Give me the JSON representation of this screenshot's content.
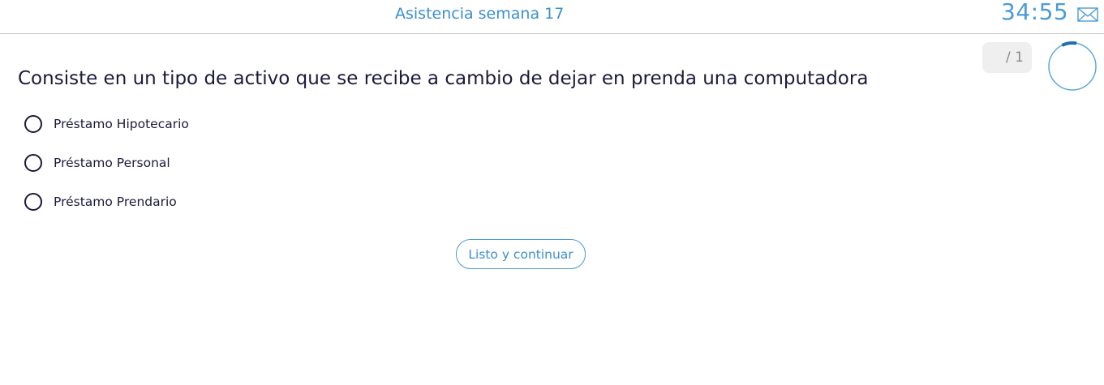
{
  "header": {
    "title": "Asistencia semana 17",
    "timer": "34:55",
    "mail_icon": "envelope-icon"
  },
  "progress": {
    "counter_text": "/ 1",
    "ring_fraction": 0.1,
    "ring_color": "#1f6fa8",
    "ring_track_color": "#5aa9dc"
  },
  "question": {
    "text": "Consiste en un tipo de activo que se recibe a cambio de dejar en prenda una computadora",
    "options": [
      {
        "label": "Préstamo Hipotecario",
        "selected": false
      },
      {
        "label": "Préstamo Personal",
        "selected": false
      },
      {
        "label": "Préstamo Prendario",
        "selected": false
      }
    ]
  },
  "actions": {
    "continue_label": "Listo y continuar"
  },
  "colors": {
    "accent": "#3a8fd0",
    "text": "#1b1b3a",
    "divider": "#c9c9c9"
  }
}
